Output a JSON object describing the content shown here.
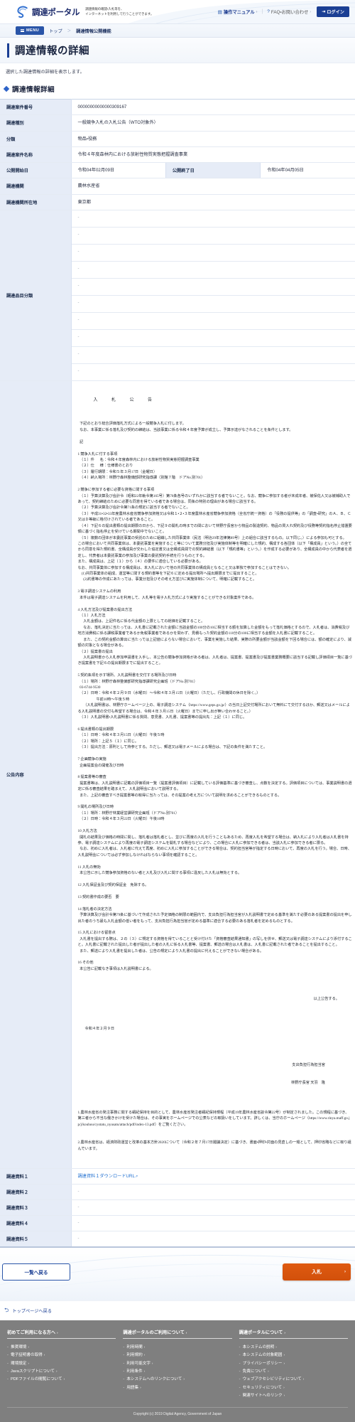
{
  "header": {
    "logo_text": "調達ポータル",
    "logo_icon": "swirl-logo-icon",
    "tagline_line1": "調達情報の確認・入札等を、",
    "tagline_line2": "インターネットを利用して行うことができます。",
    "manual_link": "操作マニュアル",
    "manual_icon": "book-icon",
    "faq_link": "FAQ・お問い合わせ",
    "faq_icon": "question-icon",
    "login_label": "ログイン",
    "login_icon": "login-door-icon",
    "accent_color": "#1b3f94"
  },
  "breadcrumb": {
    "menu_label": "MENU",
    "menu_icon": "hamburger-icon",
    "items": [
      {
        "label": "トップ"
      },
      {
        "label": "調達情報公開機能"
      }
    ],
    "separator": "＞"
  },
  "page": {
    "title": "調達情報の詳細",
    "lede": "選択した調達情報の詳細を表示します。",
    "section_title": "調達情報詳細",
    "section_icon": "diamond-bullet-icon"
  },
  "detail": {
    "case_number_label": "調達案件番号",
    "case_number_value": "00000000000000309167",
    "kind_label": "調達種別",
    "kind_value": "一般競争入札の入札公告（WTO対象外）",
    "category_label": "分類",
    "category_value": "物品・役務",
    "case_name_label": "調達案件名称",
    "case_name_value": "令和４年度森林内における放射性物質実態把握調査事業",
    "publish_start_label": "公開開始日",
    "publish_start_value": "令和04年02月09日",
    "publish_end_label": "公開終了日",
    "publish_end_value": "令和04年04月05日",
    "agency_label": "調達機関",
    "agency_value": "農林水産省",
    "agency_location_label": "調達機関所在地",
    "agency_location_value": "東京都",
    "item_class_label": "調達品目分類",
    "item_class_values": [
      "-",
      "-",
      "-",
      "-",
      "-",
      "-",
      "-",
      "-",
      "-",
      "-"
    ],
    "notice_label": "公告内容",
    "material1_label": "調達資料１",
    "material1_link": "調達資料１ダウンロードURL",
    "material2_label": "調達資料２",
    "material2_value": "-",
    "material3_label": "調達資料３",
    "material3_value": "-",
    "material4_label": "調達資料４",
    "material4_value": "-",
    "material5_label": "調達資料５",
    "material5_value": "-",
    "external_link_icon": "external-link-icon"
  },
  "notice": {
    "heading": "入 札 公 告",
    "body": "  下記のとおり総合評価落札方式による一般競争入札に付します。\n  なお、本事業に係る落札及び契約の締結は、当該事業に係る令和４年度予算が成立し、予算示達がなされることを条件とします。\n\n  記\n\n1 競争入札に付する事項\n  （１）件  　名：令和４年度森林内における放射性物質実態把握調査事業\n  （２）仕  　様：仕様書のとおり\n  （３）履行期限：令和５年３月17日（金曜日）\n  （４）納入場所：林野庁森林整備部研究指導課（別館７階　ドアNo.別701）\n\n2 競争に参加する者に必要な資格に関する事項\n  （１）予算決算及び会計令（昭和22年勅令第165号）第70条各号のいずれかに該当する者でないこと。なお、競争に参加する者が未成年者、被保佐人又は被補助人であって、契約締結のために必要な同意を得ている者である場合は、同条の特別の理由がある場合に該当する。\n  （２）予算決算及び会計令第71条の規定に該当する者でないこと。\n  （３）平成31・32・33年度農林水産省競争参加資格又は令和１・２・３年度農林水産省競争参加資格（全省庁統一資格）の「役務の提供等」の「調査・研究」のＡ、Ｂ、Ｃ又はＤ等級に格付けされている者であること。\n  （４）下記６の提出書類の提出期限の日から、下記９の開札の時までの間において林野庁長官から物品の製造契約、物品の買入れ契約及び役務等契約指名停止措置要領に基づく指名停止を受けている期間中でないこと。\n  （５）複数の団体が本委託事業の受託のために組織した共同事業体（民法（明治29年法律第89号）上の組合に該当するもの。以下同じ。）による参加も可とする。\nこの場合において共同事業体は、本委託事業を実施すること等について業務分担及び実施体制等を明確にした規約、構成する各団体（以下「構成員」という。）の全てから同意を得た規約書、全構成員が交わした協定書又は全構成員間での契約締結書（以下「規約書等」という。）を作成する必要があり、全構成員の中から代表者を選定し、代表者は本委託事業の参加及び事業の委託契約手続を行うものとする。\nまた、構成員は、上記（１）から（４）の要件に適合している必要がある。\nなお、共同事業体に参加する構成員は、本入札において他の共同事業体の構成員となること又は単独で参加することはできない。\n    (1)共同事業体の組成、運営等に関する規約書等を下記６に定める提出場所へ提出期限までに提出すること。\n      (2)約書等の作成にあたっては、事業分担及びその考え方並びに実施体制について、明確に記載すること。\n\n3 電子調達システムの利用\n  本件は電子調達システムを利用して、入札等を電子入札方式により実施することができる対象案件である。\n\n4 入札方法及び提案書の提出方法\n  （１）入札方法\n      入札金額は、上記件名に係る代金額の上限としての総価を記載すること。\n      なお、落札決定に当たっては、入札書に記載された金額に当該金額の100分の10に相当する額を加算した金額をもって落札価格とするので、入札者は、消費税及び地方消費税に係る課税事業者であるか免税事業者であるかを問わず、見積もった契約金額の110分の100に相当する金額を入札書に記載すること。\n      また、この契約金額の算出に当たっては上記値によらない場合において、事業を実施した結果、実際の所要金額が当該金額を下回る場合には、額の確定により、減額の対象となる場合がある。\n  （２）提案書の提出\n      入札説明書から入札参加申請書を入手し、本公告の競争参加資格がある者は、入札者は、提案書、提案書及び提案書業務概要に該当する記載し評価項目一覧に基づき提案書を下記６の提出期限までに提出すること。\n\n5 契約条項を示す場所、入札説明書を交付する場所及び日時\n  （１）場所：林野庁森林整備部研究指導課研究企画班（ドアNo.別701）\n  03-6744-9530\n  （２）日時：令和４年２月９日（水曜日）～令和４年３月15日（火曜日）（ただし、行政機関の休日を除く。）\n                    午前10時～午後５時\n      （入札説明書は、林野庁ホームページ上の、電子調達システム（https://www.geps.go.jp/）の当日上記交付場所において無料にて交付するほか、郵送又はメールによる入札説明書の交付も希望する場合は、令和４年３月15日（火曜日）までに申し出が無い合わせること。）\n  （３）入札説明書・入札説明書に係る質問、意見書、入札書、提案書等の提出先：上記（１）に同じ。\n\n6 提出書類の提出期限\n  （１）日時：令和４年３月15日（火曜日）午後５時\n  （２）場所：上記５（１）に同じ。\n  （３）提出方法：原則として持参とする。ただし、郵送又は電子メールによる場合は、下記の条件を満たすこと。\n\n7 企画競争の実施\n  企画提案会の開催及び日時\n\n8 提案書等の審査\n  提案書等は、入札説明書に記載の評価項目一覧（提案書評価項目）に記載している評価基準に基づき審査し、点数を決定する。評価項目については、事業説明書の選定に係る審査結果を踏まえて、入札説明会において説明する。\n  また、上記の審査すべき提案書等の取得に当たっては、その提案の考え方について説明を求めることができるものとする。\n\n9 開札の場所及び日時\n  （１）場所：林野庁林業経営課研究企画班（ドアNo.別701）\n  （２）日時：令和４年３月22日（火曜日）午後10時\n\n10 入札方法\n  開札の結果及び価格の時間に関し、落札者は落札者とし、並びに再度の入札を行うこともあるため、再度入札を希望する場合は、納入札により入札者は入札書を持参、電子調達システムにより再度の電子調達システムを開札する場合などにより、この場合に入札に参加できる者は、当該入札に参加できる者に限る。\n  なお、初めに入札者は、入札者に代えて再度、初めに入札に参加することができる場合は、契約担当官等が指定する日時において、再度の入札を行う。場合、日時、入札説明会については必ず参加しなければならない事項を確認すること。\n\n11 入札の無効\n  本公告に示した競争参加資格のない者と入札及び入札に関する事項に違反した入札は無効とする。\n\n12 入札保証金及び契約保証金　免除する。\n\n13 契約書作成の要否　要\n\n14 落札者の決定方法\n  予算決算及び会計令第79条に基づいて作成された予定価格の制限の範囲内で、支出負担行為担当官が入札説明書で定める基準を満たす必要のある提案書の提出を申し出た者のうち最も入札金額の低い者をもって、支出負担行為担当官が定める基準に適合する必要のある落札者を定めるものとする。\n\n15 入札における留意点\n  入札書を提出する際は、２の（３）に規定する資格を得ていることと受け付けた「資格審査結果通知書」の写しを併せ、郵送又は電子調達システムにより添付すること。入札書に記載された提出した者が提出した者の入札に係る入札書等、提案書、郵送の場合は入札書は、入札書に記載された者であることを提出すること。\n  また、郵送により入札書を提出した者は、公告の規定により入札書の提出に代えることができない場合がある。\n\n16 その他\n  本公告に記載なき事項は入札説明書による。",
    "closing": "以上公告する。",
    "date": "令和４年２月９日",
    "signer_title": "支出負担行為担当官",
    "signer_name": "林野庁長官 天羽　隆",
    "footnote1": "1.農林水産省の発注事務に関する綱紀保持を目的として、農林水産省発注者綱紀保持規程（平成19年農林水産省訓令第22号）が制定されました。この規程に基づき、第三者から不当な働きかけを受けた場合は、その事実をホームページでの公表などの取扱いをしています。詳しくは、当庁のホームページ（https://www.rinya.maff.go.jp/j/kouhou/cyotatu_nyusatu/attach/pdf/index-13.pdf）をご覧ください。",
    "footnote2": "2.農林水産省は、経済財政運営と改革の基本方針2020について（令和２年７月17日閣議決定）に基づき、書面・押印・対面の見直しの一環として、押印省略などに取り組んでいます。"
  },
  "actions": {
    "back_label": "一覧へ戻る",
    "bid_label": "入札",
    "bid_chevron": "›",
    "bid_color": "#d2500b"
  },
  "to_top": {
    "label": "トップページへ戻る",
    "icon": "return-arrow-icon"
  },
  "footer": {
    "columns": [
      {
        "title": "初めてご利用になる方へ",
        "links": [
          "推奨環境",
          "電子証明書の取得",
          "環境設定",
          "Javaスクリプトについて",
          "PDFファイルの閲覧について"
        ]
      },
      {
        "title": "調達ポータルのご利用について",
        "links": [
          "利用時間",
          "利用規約",
          "利用可能文字",
          "利用条件",
          "本システムへのリンクについて",
          "用語集"
        ]
      },
      {
        "title": "調達ポータルについて",
        "links": [
          "本システムの説明",
          "本システムの対象範囲",
          "プライバシーポリシー",
          "免責について",
          "ウェブアクセシビリティについて",
          "セキュリティについて",
          "関連サイトへのリンク"
        ]
      }
    ],
    "copyright": "Copyright (c) 2019 Digital Agency, Government of Japan",
    "background_color": "#7f7f7f"
  }
}
